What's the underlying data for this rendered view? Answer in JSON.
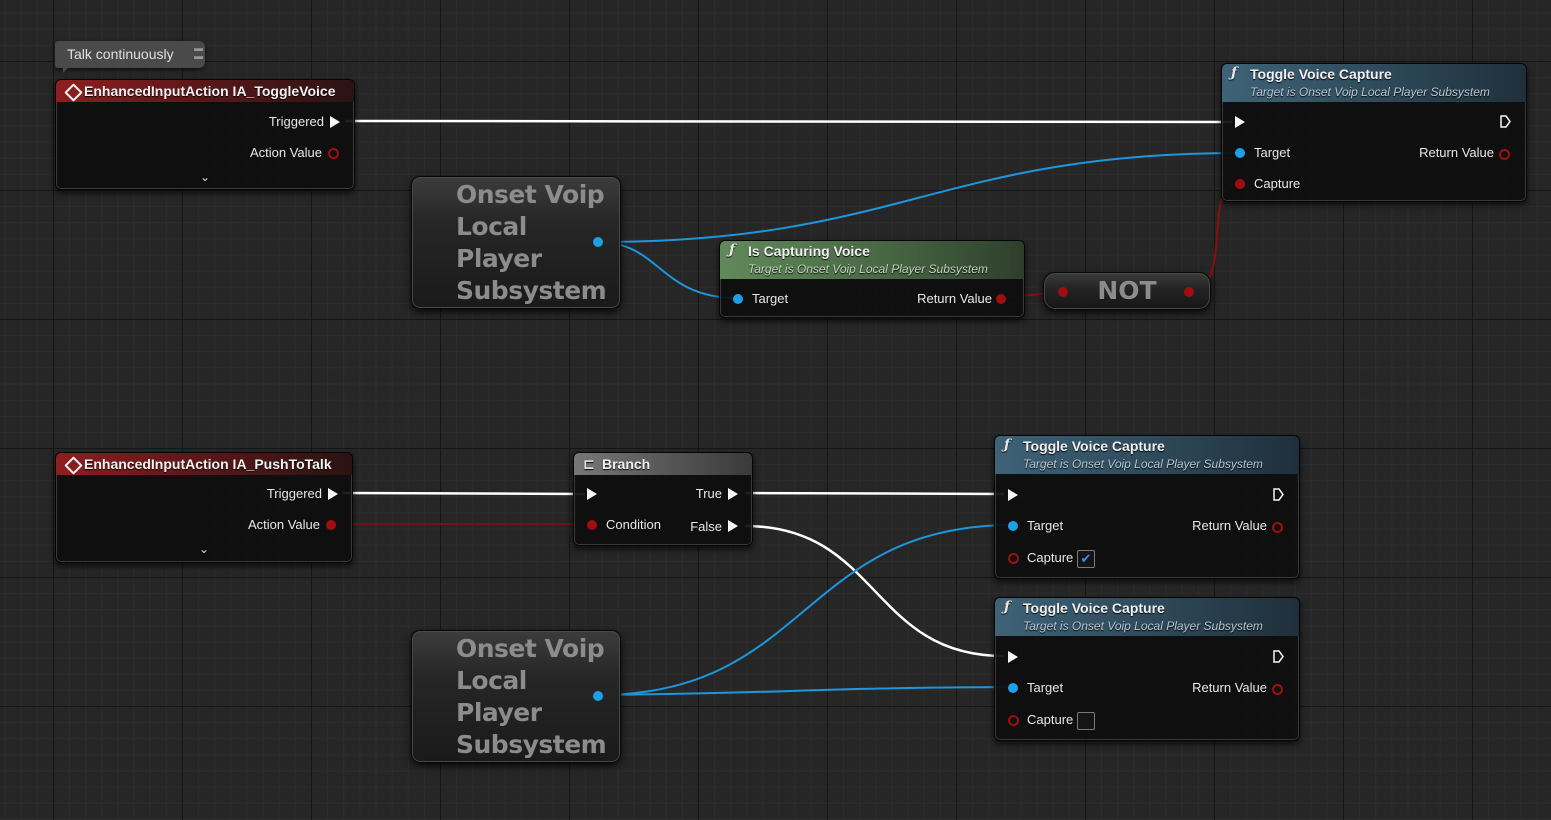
{
  "comment": {
    "text": "Talk continuously"
  },
  "event_toggle": {
    "title": "EnhancedInputAction IA_ToggleVoice",
    "triggered": "Triggered",
    "action_value": "Action Value",
    "expand_icon": "chevron-down-icon"
  },
  "event_ptt": {
    "title": "EnhancedInputAction IA_PushToTalk",
    "triggered": "Triggered",
    "action_value": "Action Value",
    "expand_icon": "chevron-down-icon"
  },
  "var_top": {
    "title": "Onset Voip Local Player Subsystem"
  },
  "var_bottom": {
    "title": "Onset Voip Local Player Subsystem"
  },
  "is_capturing": {
    "title": "Is Capturing Voice",
    "subtitle": "Target is Onset Voip Local Player Subsystem",
    "target": "Target",
    "return_value": "Return Value"
  },
  "not_node": {
    "title": "NOT"
  },
  "toggle_top": {
    "title": "Toggle Voice Capture",
    "subtitle": "Target is Onset Voip Local Player Subsystem",
    "target": "Target",
    "return_value": "Return Value",
    "capture": "Capture"
  },
  "branch": {
    "title": "Branch",
    "condition": "Condition",
    "true_label": "True",
    "false_label": "False"
  },
  "toggle_true": {
    "title": "Toggle Voice Capture",
    "subtitle": "Target is Onset Voip Local Player Subsystem",
    "target": "Target",
    "return_value": "Return Value",
    "capture": "Capture",
    "capture_checked": true,
    "check_glyph": "✔"
  },
  "toggle_false": {
    "title": "Toggle Voice Capture",
    "subtitle": "Target is Onset Voip Local Player Subsystem",
    "target": "Target",
    "return_value": "Return Value",
    "capture": "Capture",
    "capture_checked": false
  },
  "icons": {
    "function": "ƒ",
    "branch": "branch-icon",
    "event": "event-diamond-icon"
  },
  "colors": {
    "exec_wire": "#ffffff",
    "object_wire": "#1e96dc",
    "bool_wire": "#8c0e0e",
    "event_header": "#8e1e1f",
    "function_header": "#3e6277",
    "pure_header": "#61895b"
  }
}
